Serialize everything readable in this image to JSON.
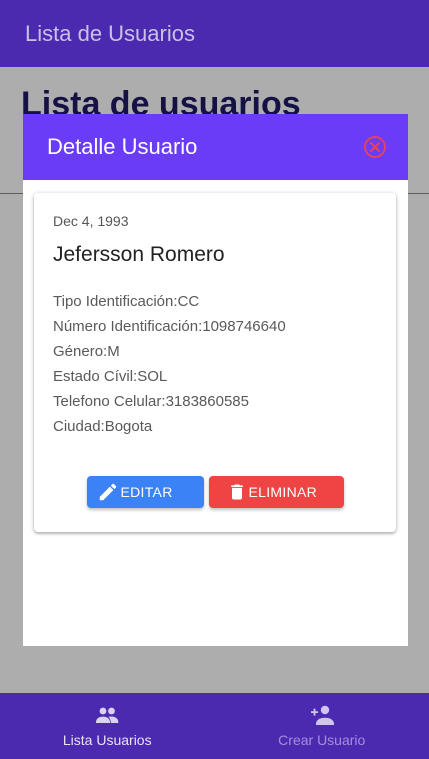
{
  "app": {
    "title": "Lista de Usuarios"
  },
  "page": {
    "heading": "Lista de usuarios"
  },
  "modal": {
    "title": "Detalle Usuario",
    "close_icon": "circle-close-icon",
    "colors": {
      "header": "#6b3cf5",
      "close": "#e5425a"
    }
  },
  "user": {
    "date": "Dec 4, 1993",
    "name": "Jefersson Romero",
    "details": [
      "Tipo Identificación:CC",
      "Número Identificación:1098746640",
      "Género:M",
      "Estado Cívil:SOL",
      "Telefono Celular:3183860585",
      "Ciudad:Bogota"
    ]
  },
  "actions": {
    "edit_label": "EDITAR",
    "edit_icon": "pencil-icon",
    "delete_label": "ELIMINAR",
    "delete_icon": "trash-icon",
    "colors": {
      "edit": "#3b82f6",
      "delete": "#ef4444"
    }
  },
  "nav": {
    "items": [
      {
        "label": "Lista Usuarios",
        "icon": "users-icon",
        "active": true
      },
      {
        "label": "Crear Usuario",
        "icon": "add-user-icon",
        "active": false
      }
    ]
  },
  "colors": {
    "primary": "#4c2ab0"
  }
}
